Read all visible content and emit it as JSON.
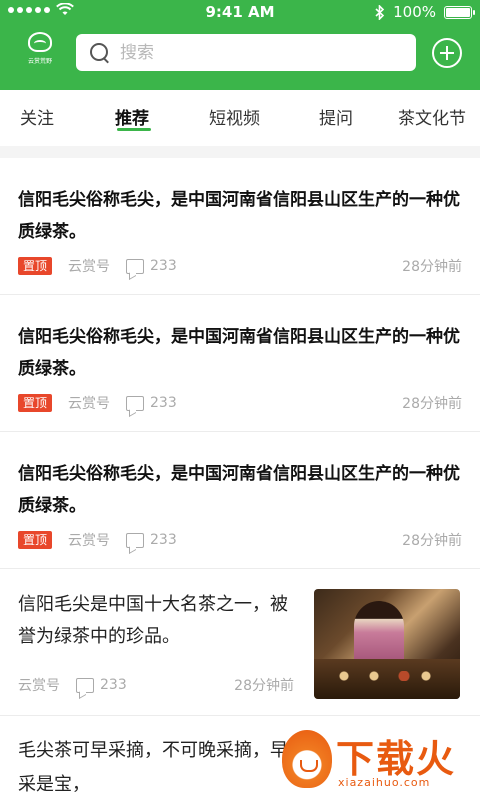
{
  "status_bar": {
    "time": "9:41 AM",
    "battery": "100%",
    "battery_level": 1.0
  },
  "header": {
    "logo_text": "云赏荒野",
    "search_placeholder": "搜索"
  },
  "tabs": [
    {
      "label": "关注",
      "active": false
    },
    {
      "label": "推荐",
      "active": true
    },
    {
      "label": "短视频",
      "active": false
    },
    {
      "label": "提问",
      "active": false
    },
    {
      "label": "茶文化节",
      "active": false
    }
  ],
  "feed": [
    {
      "title": "信阳毛尖俗称毛尖，是中国河南省信阳县山区生产的一种优质绿茶。",
      "badge": "置顶",
      "source": "云赏号",
      "comments": "233",
      "time": "28分钟前"
    },
    {
      "title": "信阳毛尖俗称毛尖，是中国河南省信阳县山区生产的一种优质绿茶。",
      "badge": "置顶",
      "source": "云赏号",
      "comments": "233",
      "time": "28分钟前"
    },
    {
      "title": "信阳毛尖俗称毛尖，是中国河南省信阳县山区生产的一种优质绿茶。",
      "badge": "置顶",
      "source": "云赏号",
      "comments": "233",
      "time": "28分钟前"
    },
    {
      "title": "信阳毛尖是中国十大名茶之一，被誉为绿茶中的珍品。",
      "source": "云赏号",
      "comments": "233",
      "time": "28分钟前",
      "has_image": true
    },
    {
      "title": "毛尖茶可早采摘，不可晚采摘，早采是宝，"
    }
  ],
  "watermark": {
    "text": "下载火",
    "sub": "xiazaihuo.com"
  },
  "colors": {
    "brand_green": "#3bb54a",
    "badge_red": "#e8472b"
  }
}
